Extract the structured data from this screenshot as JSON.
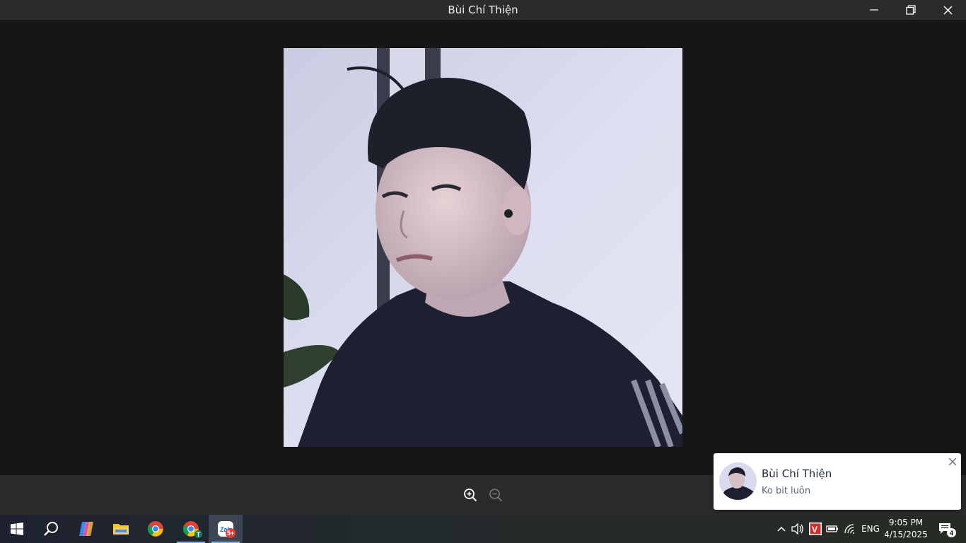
{
  "window": {
    "title": "Bùi Chí Thiện",
    "controls": [
      "minimize",
      "maximize",
      "close"
    ]
  },
  "viewer": {
    "image_alt": "Profile photo",
    "zoom_controls": [
      "zoom-in-icon",
      "zoom-out-icon"
    ]
  },
  "notification": {
    "sender": "Bùi Chí Thiện",
    "message": "Ko bit luôn"
  },
  "taskbar": {
    "apps": [
      {
        "name": "start",
        "icon": "windows-logo-icon"
      },
      {
        "name": "search",
        "icon": "search-icon"
      },
      {
        "name": "copilot",
        "icon": "copilot-icon"
      },
      {
        "name": "file-explorer",
        "icon": "folder-icon"
      },
      {
        "name": "chrome",
        "icon": "chrome-icon"
      },
      {
        "name": "chrome-profile",
        "icon": "chrome-profile-icon",
        "profile_letter": "T"
      },
      {
        "name": "zalo",
        "icon": "zalo-icon",
        "badge": "5+",
        "app_letters": "Zal"
      }
    ],
    "tray": {
      "language": "ENG",
      "time": "9:05 PM",
      "date": "4/15/2025",
      "notification_count": "4",
      "app_letter": "V"
    }
  },
  "colors": {
    "titlebar": "#2b2b2b",
    "viewer_bg": "#161616",
    "accent": "#7fb2e6",
    "badge_red": "#e53935"
  }
}
